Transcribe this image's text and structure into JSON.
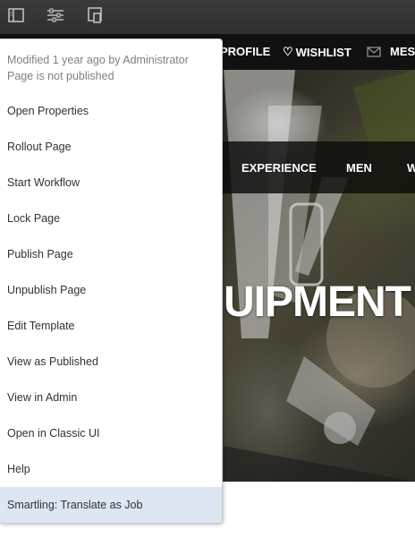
{
  "toolbar": {
    "buttons": [
      {
        "icon": "side-panel-icon"
      },
      {
        "icon": "page-properties-icon"
      },
      {
        "icon": "emulator-icon"
      }
    ]
  },
  "site": {
    "top_links": {
      "profile": "PROFILE",
      "wishlist": "WISHLIST",
      "messages": "MES"
    },
    "categories": {
      "experience": "EXPERIENCE",
      "men": "MEN",
      "women": "W"
    },
    "headline": "UIPMENT"
  },
  "menu": {
    "modified": "Modified 1 year ago by Administrator",
    "status": "Page is not published",
    "items": [
      {
        "label": "Open Properties"
      },
      {
        "label": "Rollout Page"
      },
      {
        "label": "Start Workflow"
      },
      {
        "label": "Lock Page"
      },
      {
        "label": "Publish Page"
      },
      {
        "label": "Unpublish Page"
      },
      {
        "label": "Edit Template"
      },
      {
        "label": "View as Published"
      },
      {
        "label": "View in Admin"
      },
      {
        "label": "Open in Classic UI"
      },
      {
        "label": "Help"
      },
      {
        "label": "Smartling: Translate as Job"
      }
    ],
    "active_item": "Smartling: Translate as Job"
  },
  "colors": {
    "toolbar_bg": "#333333",
    "menu_highlight": "#dde6f3",
    "menu_text": "#323232",
    "menu_meta_text": "#808080"
  }
}
